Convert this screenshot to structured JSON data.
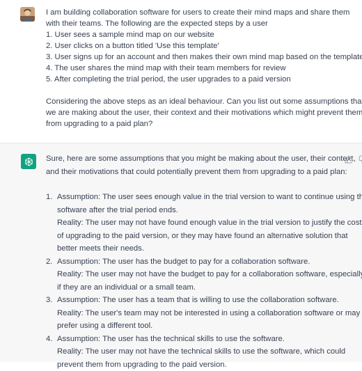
{
  "user_message": {
    "lines": [
      "I am building collaboration software for users to create their mind maps and share them",
      "with their teams. The following are the expected steps by a user",
      "1. User sees a sample mind map on our website",
      "2. User clicks on a button titled 'Use this template'",
      "3. User signs up for an account and then makes their own mind map based on the template",
      "4. The user shares the mind map with their team members for review",
      "5. After completing the trial period, the user upgrades to a paid version"
    ],
    "question_lines": [
      "Considering the above steps as an ideal behaviour. Can you list out some assumptions that",
      "we are making about the user, their context and their motivations which might prevent them",
      "from upgrading to a paid plan?"
    ]
  },
  "assistant_message": {
    "intro_lines": [
      "Sure, here are some assumptions that you might be making about the user, their context,",
      "and their motivations that could potentially prevent them from upgrading to a paid plan:"
    ],
    "items": [
      {
        "number": "1.",
        "lines": [
          "Assumption: The user sees enough value in the trial version to want to continue using the",
          "software after the trial period ends.",
          "Reality: The user may not have found enough value in the trial version to justify the cost",
          "of upgrading to the paid version, or they may have found an alternative solution that",
          "better meets their needs."
        ]
      },
      {
        "number": "2.",
        "lines": [
          "Assumption: The user has the budget to pay for a collaboration software.",
          "Reality: The user may not have the budget to pay for a collaboration software, especially",
          "if they are an individual or a small team."
        ]
      },
      {
        "number": "3.",
        "lines": [
          "Assumption: The user has a team that is willing to use the collaboration software.",
          "Reality: The user's team may not be interested in using a collaboration software or may",
          "prefer using a different tool."
        ]
      },
      {
        "number": "4.",
        "lines": [
          "Assumption: The user has the technical skills to use the software.",
          "Reality: The user may not have the technical skills to use the software, which could",
          "prevent them from upgrading to the paid version."
        ]
      }
    ]
  },
  "colors": {
    "assistant_bg": "#f7f7f8",
    "brand_green": "#10a37f",
    "text": "#374151"
  },
  "icons": {
    "user_avatar": "user-avatar-photo",
    "assistant_avatar": "openai-logo-icon",
    "thumbs_up": "thumbs-up-icon",
    "thumbs_down": "thumbs-down-icon"
  }
}
